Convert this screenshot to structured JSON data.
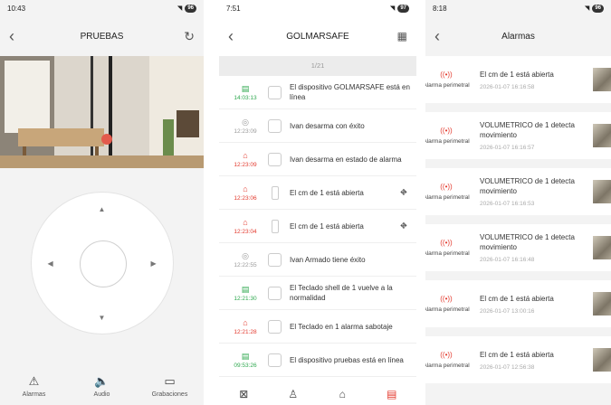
{
  "screen1": {
    "status": {
      "time": "10:43",
      "battery": "96"
    },
    "title": "PRUEBAS",
    "tabs": [
      {
        "label": "Alarmas",
        "icon": "alarm-icon"
      },
      {
        "label": "Audio",
        "icon": "speaker-icon"
      },
      {
        "label": "Grabaciones",
        "icon": "sdcard-icon"
      }
    ]
  },
  "screen2": {
    "status": {
      "time": "7:51",
      "battery": "97"
    },
    "title": "GOLMARSAFE",
    "page_indicator": "1/21",
    "events": [
      {
        "time": "14:03:13",
        "text": "El dispositivo GOLMARSAFE está en línea",
        "type": "info"
      },
      {
        "time": "12:23:09",
        "text": "Ivan  desarma  con éxito",
        "type": "system"
      },
      {
        "time": "12:23:09",
        "text": "Ivan  desarma  en estado de alarma",
        "type": "alarm"
      },
      {
        "time": "12:23:06",
        "text": "El cm de 1 está abierta",
        "type": "alarm",
        "sensor": true
      },
      {
        "time": "12:23:04",
        "text": "El cm de 1 está abierta",
        "type": "alarm",
        "sensor": true
      },
      {
        "time": "12:22:55",
        "text": "Ivan  Armado  tiene éxito",
        "type": "system"
      },
      {
        "time": "12:21:30",
        "text": "El Teclado shell de 1 vuelve a la normalidad",
        "type": "info"
      },
      {
        "time": "12:21:28",
        "text": "El Teclado en 1 alarma sabotaje",
        "type": "alarm"
      },
      {
        "time": "09:53:26",
        "text": "El dispositivo pruebas está en línea",
        "type": "info"
      }
    ],
    "colors": {
      "info": "#2fa84f",
      "system": "#9a9a9a",
      "alarm": "#e33a2e"
    }
  },
  "screen3": {
    "status": {
      "time": "8:18",
      "battery": "96"
    },
    "title": "Alarmas",
    "alarms": [
      {
        "source": "Alarma perimetral",
        "message": "El cm de 1 está abierta",
        "timestamp": "2026-01-07 16:16:58"
      },
      {
        "source": "Alarma perimetral",
        "message": "VOLUMETRICO de 1 detecta movimiento",
        "timestamp": "2026-01-07 16:16:57"
      },
      {
        "source": "Alarma perimetral",
        "message": "VOLUMETRICO de 1 detecta movimiento",
        "timestamp": "2026-01-07 16:16:53"
      },
      {
        "source": "Alarma perimetral",
        "message": "VOLUMETRICO de 1 detecta movimiento",
        "timestamp": "2026-01-07 16:16:48"
      },
      {
        "source": "Alarma perimetral",
        "message": "El cm de 1 está abierta",
        "timestamp": "2026-01-07 13:00:16"
      },
      {
        "source": "Alarma perimetral",
        "message": "El cm de 1 está abierta",
        "timestamp": "2026-01-07 12:56:38"
      }
    ]
  }
}
